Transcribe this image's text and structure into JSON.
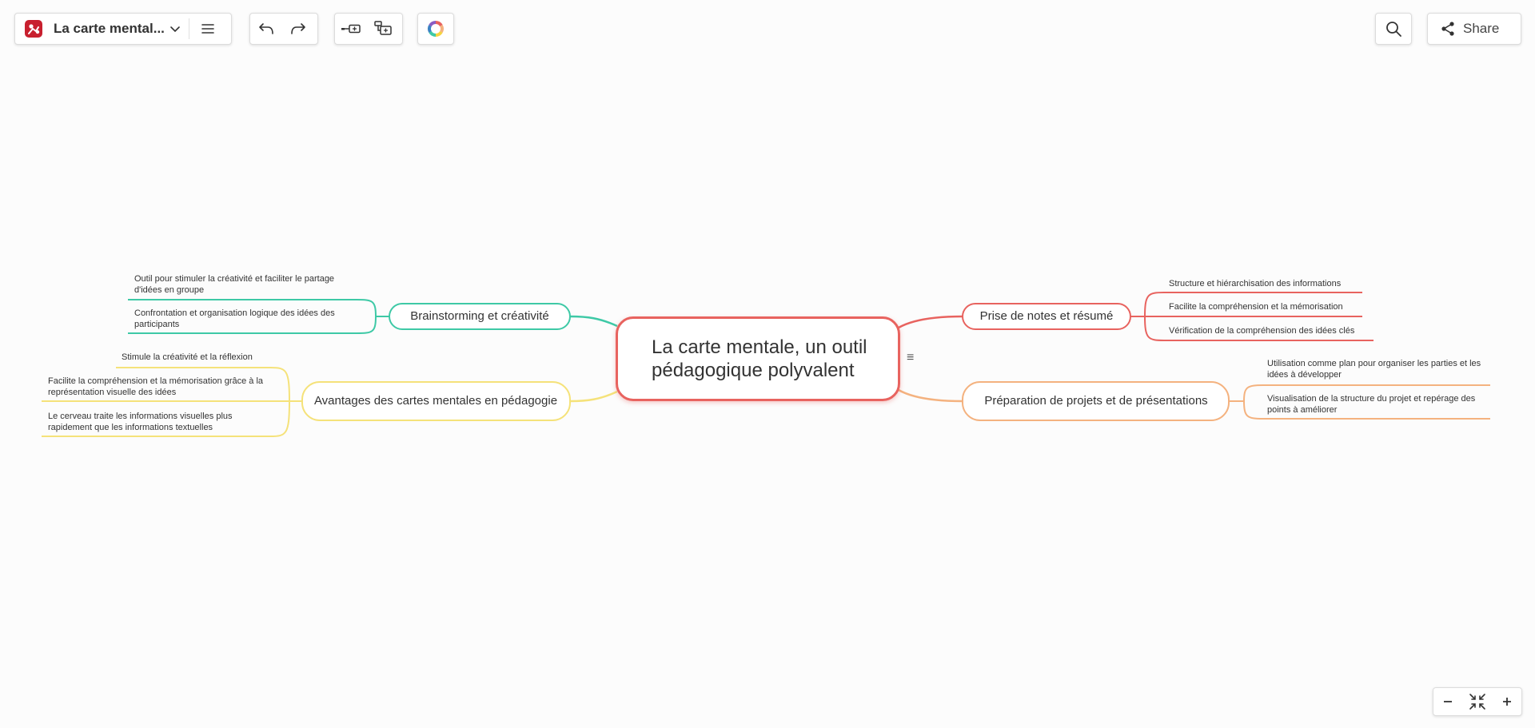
{
  "header": {
    "doc_title": "La carte mental...",
    "share_label": "Share"
  },
  "icons": {
    "app_logo": "app-logo",
    "title_dropdown": "chevron-down-icon",
    "menu": "hamburger-menu-icon",
    "undo": "undo-icon",
    "redo": "redo-icon",
    "add_sibling": "add-sibling-node-icon",
    "add_child": "add-child-node-icon",
    "theme": "color-palette-icon",
    "search": "search-icon",
    "share": "share-icon",
    "zoom_out": "minus-icon",
    "fit": "fit-to-screen-icon",
    "zoom_in": "plus-icon"
  },
  "colors": {
    "central": "#e8635f",
    "brainstorming": "#3ec9a6",
    "avantages": "#f5e27a",
    "prise_notes": "#e8635f",
    "preparation": "#f4b27f",
    "brand": "#c8202f"
  },
  "mindmap": {
    "central": "La carte mentale, un outil pédagogique polyvalent",
    "branches": {
      "brainstorming": {
        "label": "Brainstorming et créativité",
        "children": [
          "Outil pour stimuler la créativité et faciliter le partage d'idées en groupe",
          "Confrontation et organisation logique des idées des participants"
        ]
      },
      "avantages": {
        "label": "Avantages des cartes mentales en pédagogie",
        "children": [
          "Stimule la créativité et la réflexion",
          "Facilite la compréhension et la mémorisation grâce à la représentation visuelle des idées",
          "Le cerveau traite les informations visuelles plus rapidement que les informations textuelles"
        ]
      },
      "prise_notes": {
        "label": "Prise de notes et résumé",
        "children": [
          "Structure et hiérarchisation des informations",
          "Facilite la compréhension et la mémorisation",
          "Vérification de la compréhension des idées clés"
        ]
      },
      "preparation": {
        "label": "Préparation de projets et de présentations",
        "children": [
          "Utilisation comme plan pour organiser les parties et les idées à développer",
          "Visualisation de la structure du projet et repérage des points à améliorer"
        ]
      }
    }
  }
}
